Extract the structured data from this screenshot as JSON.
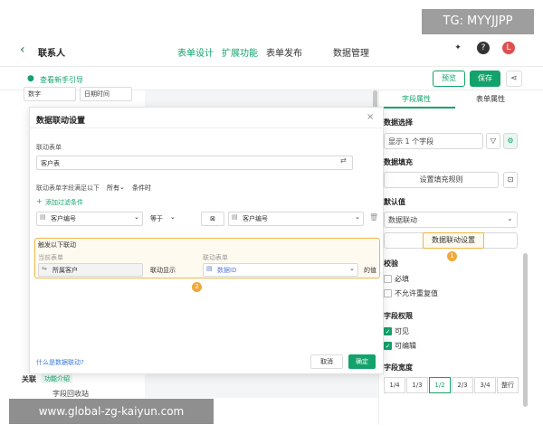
{
  "watermark_top": "TG: MYYJJPP",
  "watermark_bottom": "www.global-zg-kaiyun.com",
  "header": {
    "title": "联系人",
    "tabs": [
      "表单设计",
      "扩展功能",
      "表单发布",
      "数据管理"
    ],
    "active_tab": "表单设计",
    "avatar": "L"
  },
  "subbar": {
    "guide": "查看新手引导",
    "preview": "预览",
    "save": "保存"
  },
  "left_fields": [
    "数字",
    "日期时间"
  ],
  "left_bottom": {
    "section": "关联",
    "feature_tag": "功能介绍",
    "recycle": "字段回收站"
  },
  "right_panel": {
    "tabs": [
      "字段属性",
      "表单属性"
    ],
    "data_select_label": "数据选择",
    "data_select_value": "显示 1 个字段",
    "data_fill_label": "数据填充",
    "fill_rule_button": "设置填充规则",
    "default_label": "默认值",
    "default_value": "数据联动",
    "linkage_button": "数据联动设置",
    "validate_label": "校验",
    "checks": [
      "必填",
      "不允许重复值"
    ],
    "perm_label": "字段权限",
    "perms": [
      "可见",
      "可编辑"
    ],
    "width_label": "字段宽度",
    "widths": [
      "1/4",
      "1/3",
      "1/2",
      "2/3",
      "3/4",
      "整行"
    ],
    "selected_width": "1/2"
  },
  "modal": {
    "title": "数据联动设置",
    "linked_form_label": "联动表单",
    "linked_form_value": "客户表",
    "condition_text": "联动表单字段满足以下",
    "condition_mode": "所有",
    "condition_suffix": "条件时",
    "add_filter": "添加过滤条件",
    "filter_left": "客户编号",
    "filter_op": "等于",
    "filter_right": "客户编号",
    "trigger_title": "触发以下联动",
    "current_form_label": "当前表单",
    "linked_form_col_label": "联动表单",
    "current_field": "所属客户",
    "display_text": "联动显示",
    "linked_field": "数据ID",
    "value_suffix": "的值",
    "help_link": "什么是数据联动?",
    "cancel": "取消",
    "confirm": "确定"
  },
  "badges": [
    "1",
    "2"
  ],
  "colors": {
    "accent": "#13a26b",
    "highlight": "#f0a83a"
  }
}
